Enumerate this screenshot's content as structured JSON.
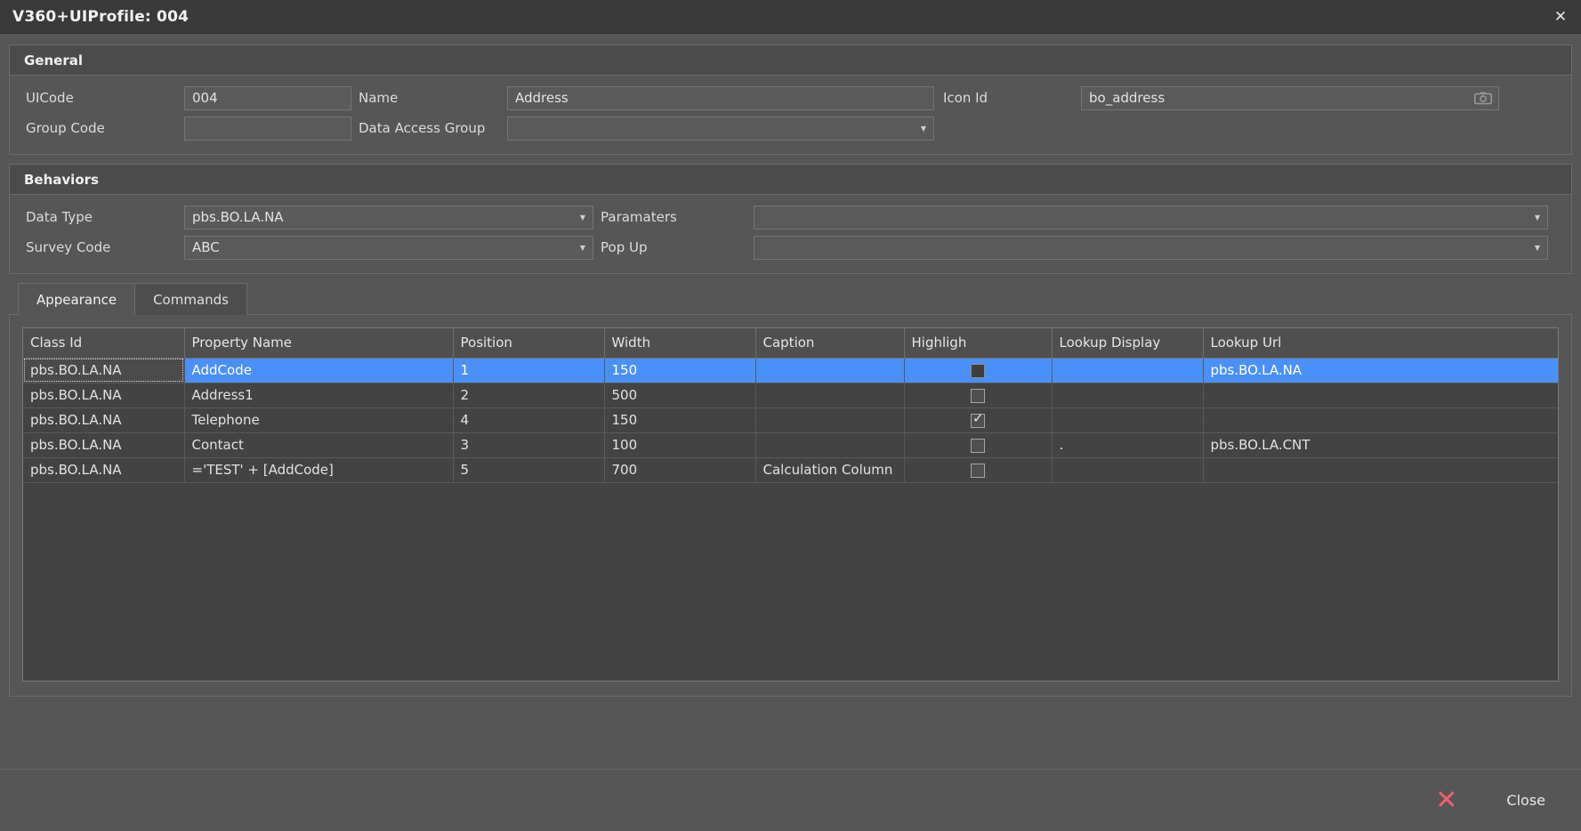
{
  "window": {
    "title": "V360+UIProfile: 004",
    "close_glyph": "✕"
  },
  "general": {
    "section_title": "General",
    "uicode_label": "UICode",
    "uicode_value": "004",
    "name_label": "Name",
    "name_value": "Address",
    "icon_id_label": "Icon Id",
    "icon_id_value": "bo_address",
    "group_code_label": "Group Code",
    "group_code_value": "",
    "data_access_group_label": "Data Access Group",
    "data_access_group_value": ""
  },
  "behaviors": {
    "section_title": "Behaviors",
    "data_type_label": "Data Type",
    "data_type_value": "pbs.BO.LA.NA",
    "parameters_label": "Paramaters",
    "parameters_value": "",
    "survey_code_label": "Survey Code",
    "survey_code_value": "ABC",
    "popup_label": "Pop Up",
    "popup_value": ""
  },
  "tabs": [
    {
      "label": "Appearance",
      "active": true
    },
    {
      "label": "Commands",
      "active": false
    }
  ],
  "grid": {
    "columns": [
      "Class Id",
      "Property Name",
      "Position",
      "Width",
      "Caption",
      "Highligh",
      "Lookup Display",
      "Lookup Url"
    ],
    "rows": [
      {
        "selected": true,
        "class_id": "pbs.BO.LA.NA",
        "property_name": "AddCode",
        "position": "1",
        "width": "150",
        "caption": "",
        "highligh": "filled",
        "lookup_display": "",
        "lookup_url": "pbs.BO.LA.NA"
      },
      {
        "selected": false,
        "class_id": "pbs.BO.LA.NA",
        "property_name": "Address1",
        "position": "2",
        "width": "500",
        "caption": "",
        "highligh": "unchecked",
        "lookup_display": "",
        "lookup_url": ""
      },
      {
        "selected": false,
        "class_id": "pbs.BO.LA.NA",
        "property_name": "Telephone",
        "position": "4",
        "width": "150",
        "caption": "",
        "highligh": "checked",
        "lookup_display": "",
        "lookup_url": ""
      },
      {
        "selected": false,
        "class_id": "pbs.BO.LA.NA",
        "property_name": "Contact",
        "position": "3",
        "width": "100",
        "caption": "",
        "highligh": "unchecked",
        "lookup_display": ".",
        "lookup_url": "pbs.BO.LA.CNT"
      },
      {
        "selected": false,
        "class_id": "pbs.BO.LA.NA",
        "property_name": "='TEST' + [AddCode]",
        "position": "5",
        "width": "700",
        "caption": "Calculation Column",
        "highligh": "unchecked",
        "lookup_display": "",
        "lookup_url": ""
      }
    ]
  },
  "footer": {
    "close_label": "Close",
    "close_icon_glyph": "✕"
  },
  "colors": {
    "window_bg": "#565656",
    "titlebar_bg": "#3a3a3a",
    "panel_header_bg": "#4b4b4b",
    "field_bg": "#5a5a5a",
    "grid_bg": "#434343",
    "selection_blue": "#4a90f7",
    "close_red": "#f4606a",
    "text": "#e3e3e3"
  }
}
